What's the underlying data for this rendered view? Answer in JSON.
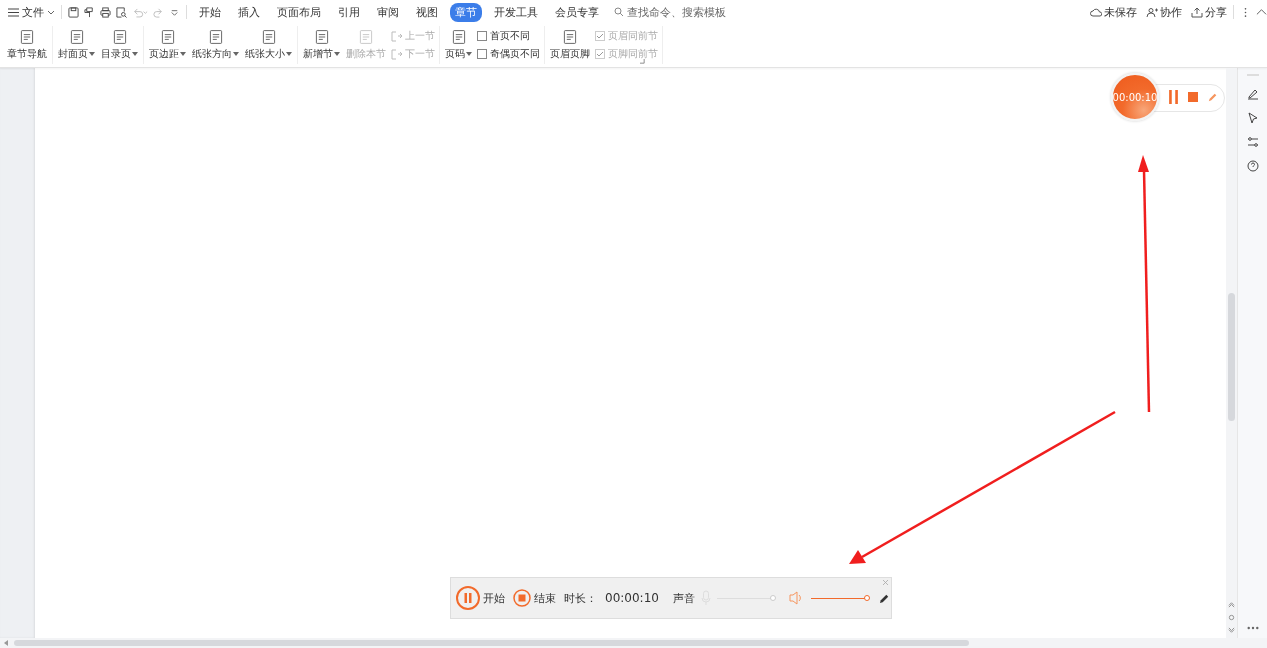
{
  "menu": {
    "file": "文件"
  },
  "tabs": [
    {
      "label": "开始",
      "selected": false
    },
    {
      "label": "插入",
      "selected": false
    },
    {
      "label": "页面布局",
      "selected": false
    },
    {
      "label": "引用",
      "selected": false
    },
    {
      "label": "审阅",
      "selected": false
    },
    {
      "label": "视图",
      "selected": false
    },
    {
      "label": "章节",
      "selected": true
    },
    {
      "label": "开发工具",
      "selected": false
    },
    {
      "label": "会员专享",
      "selected": false
    }
  ],
  "search": {
    "placeholder": "查找命令、搜索模板"
  },
  "actions": [
    "未保存",
    "协作",
    "分享"
  ],
  "ribbon": [
    [
      {
        "kind": "big",
        "label": "章节导航",
        "dropdown": false,
        "disabled": false
      }
    ],
    [
      {
        "kind": "big",
        "label": "封面页",
        "dropdown": true,
        "disabled": false
      },
      {
        "kind": "big",
        "label": "目录页",
        "dropdown": true,
        "disabled": false
      }
    ],
    [
      {
        "kind": "big",
        "label": "页边距",
        "dropdown": true,
        "disabled": false
      },
      {
        "kind": "big",
        "label": "纸张方向",
        "dropdown": true,
        "disabled": false
      },
      {
        "kind": "big",
        "label": "纸张大小",
        "dropdown": true,
        "disabled": false
      }
    ],
    [
      {
        "kind": "big",
        "label": "新增节",
        "dropdown": true,
        "disabled": false
      },
      {
        "kind": "big",
        "label": "删除本节",
        "dropdown": false,
        "disabled": true
      },
      {
        "kind": "stack",
        "items": [
          {
            "kind": "small",
            "label": "上一节",
            "disabled": true
          },
          {
            "kind": "small",
            "label": "下一节",
            "disabled": true
          }
        ]
      }
    ],
    [
      {
        "kind": "big",
        "label": "页码",
        "dropdown": true,
        "disabled": false
      },
      {
        "kind": "stack",
        "items": [
          {
            "kind": "checkbox",
            "label": "首页不同",
            "checked": false,
            "disabled": false
          },
          {
            "kind": "checkbox",
            "label": "奇偶页不同",
            "checked": false,
            "disabled": false
          }
        ]
      }
    ],
    [
      {
        "kind": "big",
        "label": "页眉页脚",
        "dropdown": false,
        "disabled": false
      },
      {
        "kind": "stack",
        "items": [
          {
            "kind": "checkbox",
            "label": "页眉同前节",
            "checked": true,
            "disabled": true
          },
          {
            "kind": "checkbox",
            "label": "页脚同前节",
            "checked": true,
            "disabled": true
          }
        ]
      }
    ]
  ],
  "recorder_widget": {
    "time": "00:00:10"
  },
  "record_bar": {
    "pause_label": "开始",
    "stop_label": "结束",
    "duration_label": "时长：",
    "duration": "00:00:10",
    "sound_label": "声音",
    "mic": {
      "level": 1,
      "disabled": true
    },
    "speaker": {
      "level": 1,
      "disabled": false
    }
  }
}
